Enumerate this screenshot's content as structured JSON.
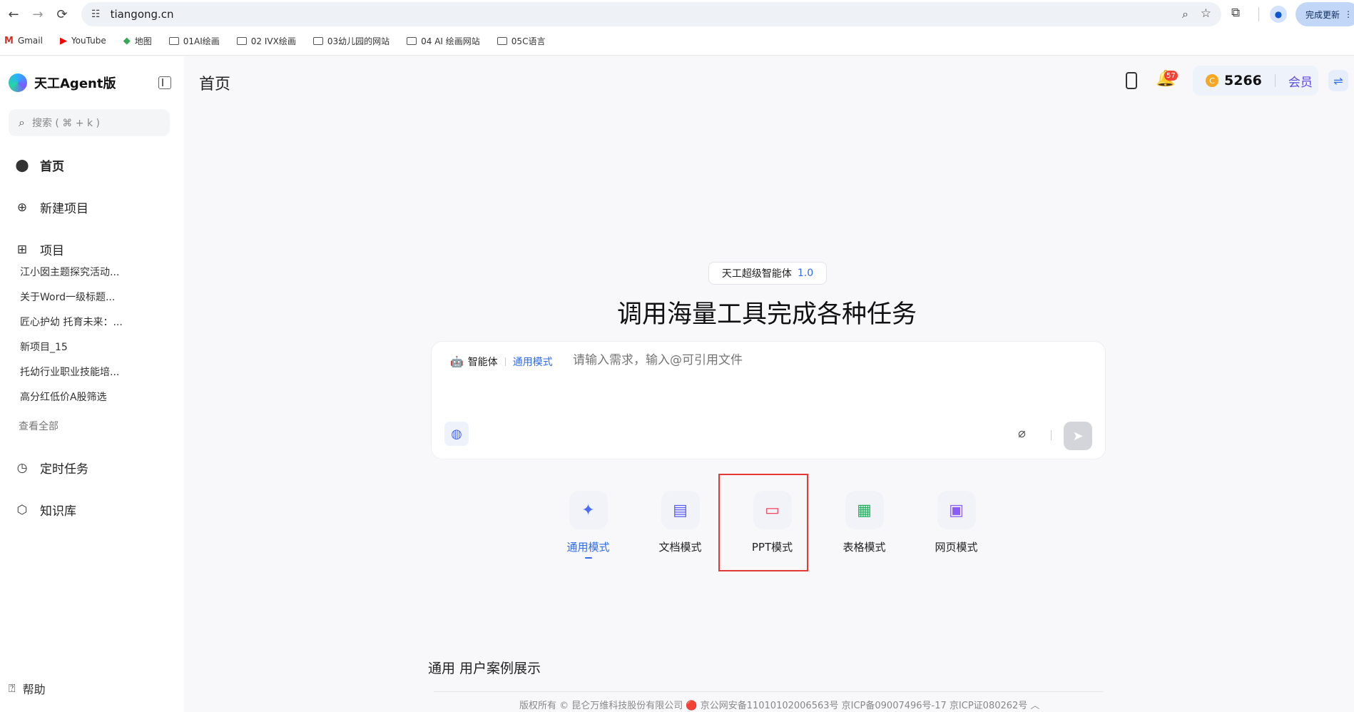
{
  "browser": {
    "url": "tiangong.cn",
    "update_label": "完成更新",
    "bookmarks": [
      "Gmail",
      "YouTube",
      "地图",
      "01AI绘画",
      "02 IVX绘画",
      "03幼儿园的网站",
      "04 AI 绘画网站",
      "05C语言"
    ]
  },
  "sidebar": {
    "brand": "天工Agent版",
    "search_placeholder": "搜索 ( ⌘ + k )",
    "nav": {
      "home": "首页",
      "new_project": "新建项目",
      "projects": "项目",
      "scheduled": "定时任务",
      "knowledge": "知识库"
    },
    "projects": [
      "江小囡主题探究活动...",
      "关于Word一级标题...",
      "匠心护幼 托育未来：...",
      "新项目_15",
      "托幼行业职业技能培...",
      "高分红低价A股筛选"
    ],
    "view_all": "查看全部",
    "help": "帮助"
  },
  "header": {
    "page_title": "首页",
    "notification_count": "57",
    "points": "5266",
    "member_label": "会员"
  },
  "hero": {
    "badge_label": "天工超级智能体",
    "badge_version": "1.0",
    "headline": "调用海量工具完成各种任务"
  },
  "composer": {
    "agent_label": "智能体",
    "mode_label": "通用模式",
    "placeholder": "请输入需求，输入@可引用文件"
  },
  "modes": [
    {
      "label": "通用模式",
      "icon": "sparkle-icon",
      "color": "#4a6cf7"
    },
    {
      "label": "文档模式",
      "icon": "document-icon",
      "color": "#5b5cf0"
    },
    {
      "label": "PPT模式",
      "icon": "presentation-icon",
      "color": "#f04461"
    },
    {
      "label": "表格模式",
      "icon": "table-icon",
      "color": "#22b35e"
    },
    {
      "label": "网页模式",
      "icon": "webpage-icon",
      "color": "#8b5cf6"
    }
  ],
  "cases_title": "通用 用户案例展示",
  "footer": "版权所有 © 昆仑万维科技股份有限公司 🔴 京公网安备11010102006563号 京ICP备09007496号-17 京ICP证080262号 ︿"
}
